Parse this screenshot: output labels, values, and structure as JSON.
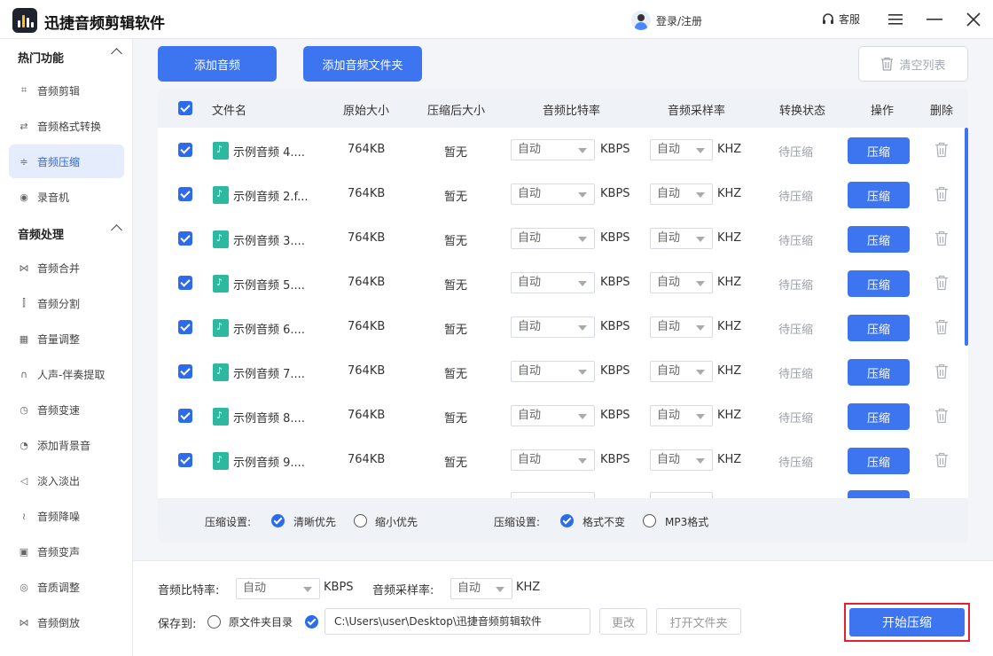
{
  "app": {
    "title": "迅捷音频剪辑软件",
    "login": "登录/注册",
    "service": "客服"
  },
  "sidebar": {
    "sections": [
      {
        "title": "热门功能",
        "items": [
          "音频剪辑",
          "音频格式转换",
          "音频压缩",
          "录音机"
        ]
      },
      {
        "title": "音频处理",
        "items": [
          "音频合并",
          "音频分割",
          "音量调整",
          "人声-伴奏提取",
          "音频变速",
          "添加背景音",
          "淡入淡出",
          "音频降噪",
          "音频变声",
          "音质调整",
          "音频倒放"
        ]
      }
    ],
    "active": "音频压缩"
  },
  "toolbar": {
    "add_audio": "添加音频",
    "add_folder": "添加音频文件夹",
    "clear": "清空列表"
  },
  "table": {
    "headers": {
      "name": "文件名",
      "orig": "原始大小",
      "after": "压缩后大小",
      "bitrate": "音频比特率",
      "samplerate": "音频采样率",
      "status": "转换状态",
      "action": "操作",
      "delete": "删除"
    },
    "rows": [
      {
        "name": "示例音频 4....",
        "orig": "764KB",
        "after": "暂无",
        "bitrate": "自动",
        "bitrate_unit": "KBPS",
        "samplerate": "自动",
        "samplerate_unit": "KHZ",
        "status": "待压缩",
        "action": "压缩"
      },
      {
        "name": "示例音频 2.f...",
        "orig": "764KB",
        "after": "暂无",
        "bitrate": "自动",
        "bitrate_unit": "KBPS",
        "samplerate": "自动",
        "samplerate_unit": "KHZ",
        "status": "待压缩",
        "action": "压缩"
      },
      {
        "name": "示例音频 3....",
        "orig": "764KB",
        "after": "暂无",
        "bitrate": "自动",
        "bitrate_unit": "KBPS",
        "samplerate": "自动",
        "samplerate_unit": "KHZ",
        "status": "待压缩",
        "action": "压缩"
      },
      {
        "name": "示例音频 5....",
        "orig": "764KB",
        "after": "暂无",
        "bitrate": "自动",
        "bitrate_unit": "KBPS",
        "samplerate": "自动",
        "samplerate_unit": "KHZ",
        "status": "待压缩",
        "action": "压缩"
      },
      {
        "name": "示例音频 6....",
        "orig": "764KB",
        "after": "暂无",
        "bitrate": "自动",
        "bitrate_unit": "KBPS",
        "samplerate": "自动",
        "samplerate_unit": "KHZ",
        "status": "待压缩",
        "action": "压缩"
      },
      {
        "name": "示例音频 7....",
        "orig": "764KB",
        "after": "暂无",
        "bitrate": "自动",
        "bitrate_unit": "KBPS",
        "samplerate": "自动",
        "samplerate_unit": "KHZ",
        "status": "待压缩",
        "action": "压缩"
      },
      {
        "name": "示例音频 8....",
        "orig": "764KB",
        "after": "暂无",
        "bitrate": "自动",
        "bitrate_unit": "KBPS",
        "samplerate": "自动",
        "samplerate_unit": "KHZ",
        "status": "待压缩",
        "action": "压缩"
      },
      {
        "name": "示例音频 9....",
        "orig": "764KB",
        "after": "暂无",
        "bitrate": "自动",
        "bitrate_unit": "KBPS",
        "samplerate": "自动",
        "samplerate_unit": "KHZ",
        "status": "待压缩",
        "action": "压缩"
      }
    ]
  },
  "compress_settings": {
    "label1": "压缩设置:",
    "opt_clear": "清晰优先",
    "opt_small": "缩小优先",
    "label2": "压缩设置:",
    "opt_keep": "格式不变",
    "opt_mp3": "MP3格式"
  },
  "bottom": {
    "bitrate_label": "音频比特率:",
    "bitrate_value": "自动",
    "bitrate_unit": "KBPS",
    "samplerate_label": "音频采样率:",
    "samplerate_value": "自动",
    "samplerate_unit": "KHZ",
    "save_label": "保存到:",
    "opt_original": "原文件夹目录",
    "path": "C:\\Users\\user\\Desktop\\迅捷音频剪辑软件",
    "change": "更改",
    "open_folder": "打开文件夹",
    "start": "开始压缩"
  },
  "colors": {
    "accent": "#3d74f0",
    "highlight": "#e0232f"
  }
}
